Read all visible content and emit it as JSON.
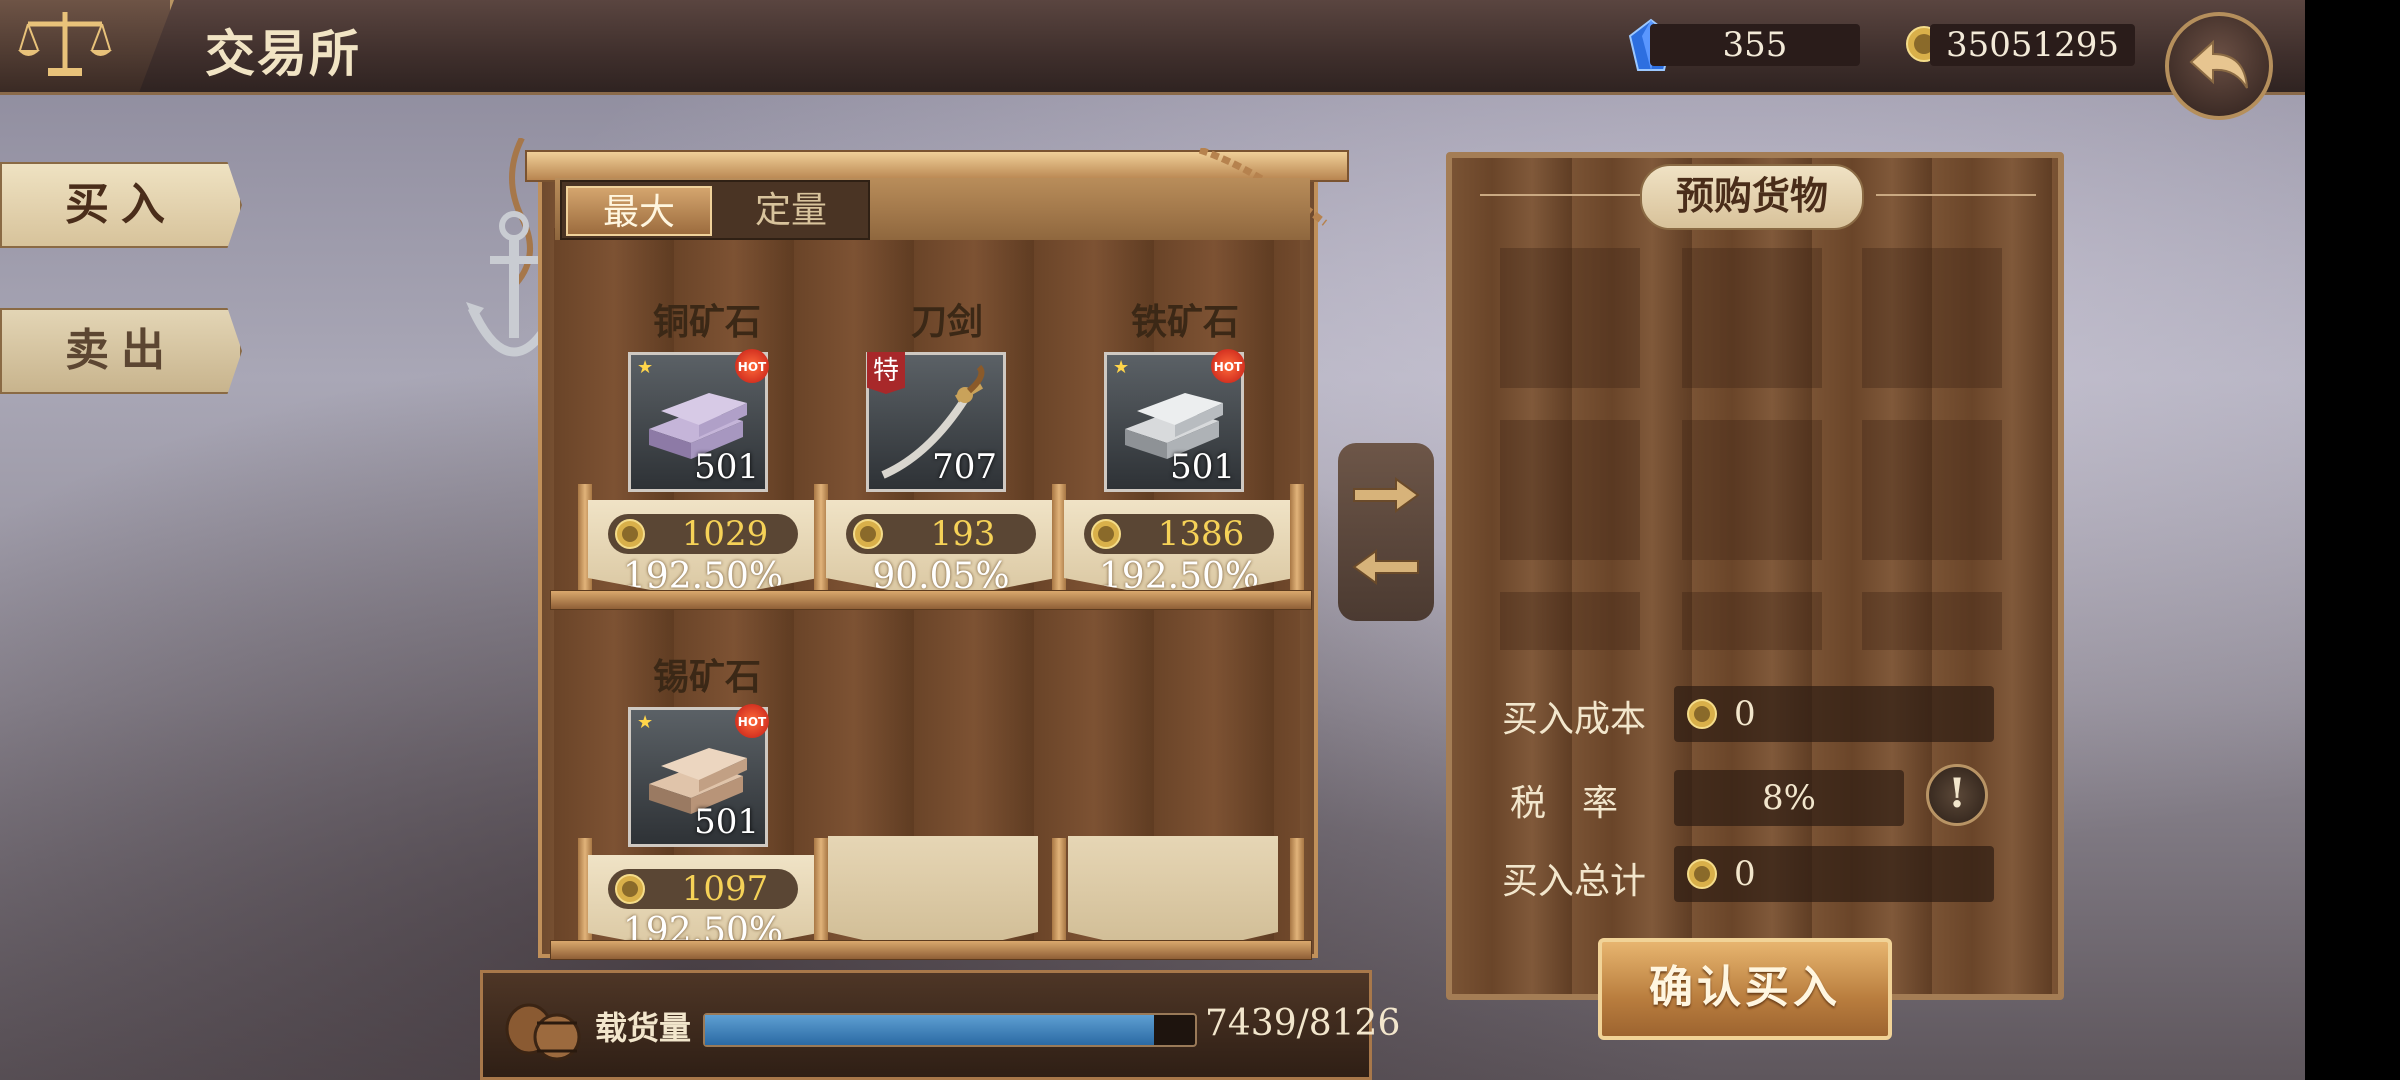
{
  "header": {
    "title": "交易所",
    "gems": "355",
    "gold": "35051295"
  },
  "side_tabs": {
    "buy": "买入",
    "sell": "卖出"
  },
  "mode": {
    "max": "最大",
    "quantity": "定量"
  },
  "items": [
    {
      "name": "铜矿石",
      "qty": "501",
      "price": "1029",
      "percent": "192.50%",
      "hot": true,
      "star": true,
      "icon": "copper-ingot-icon"
    },
    {
      "name": "刀剑",
      "qty": "707",
      "price": "193",
      "percent": "90.05%",
      "special": "特",
      "icon": "sword-icon"
    },
    {
      "name": "铁矿石",
      "qty": "501",
      "price": "1386",
      "percent": "192.50%",
      "hot": true,
      "star": true,
      "icon": "iron-ingot-icon"
    },
    {
      "name": "锡矿石",
      "qty": "501",
      "price": "1097",
      "percent": "192.50%",
      "hot": true,
      "star": true,
      "icon": "tin-ingot-icon"
    }
  ],
  "hot_badge": "HOT",
  "capacity": {
    "label": "载货量",
    "value": "7439/8126",
    "fill_fraction": 0.9155
  },
  "order_panel": {
    "title": "预购货物",
    "cost_label": "买入成本",
    "cost_value": "0",
    "tax_label": "税　率",
    "tax_value": "8%",
    "total_label": "买入总计",
    "total_value": "0",
    "info_glyph": "!",
    "confirm": "确认买入"
  }
}
